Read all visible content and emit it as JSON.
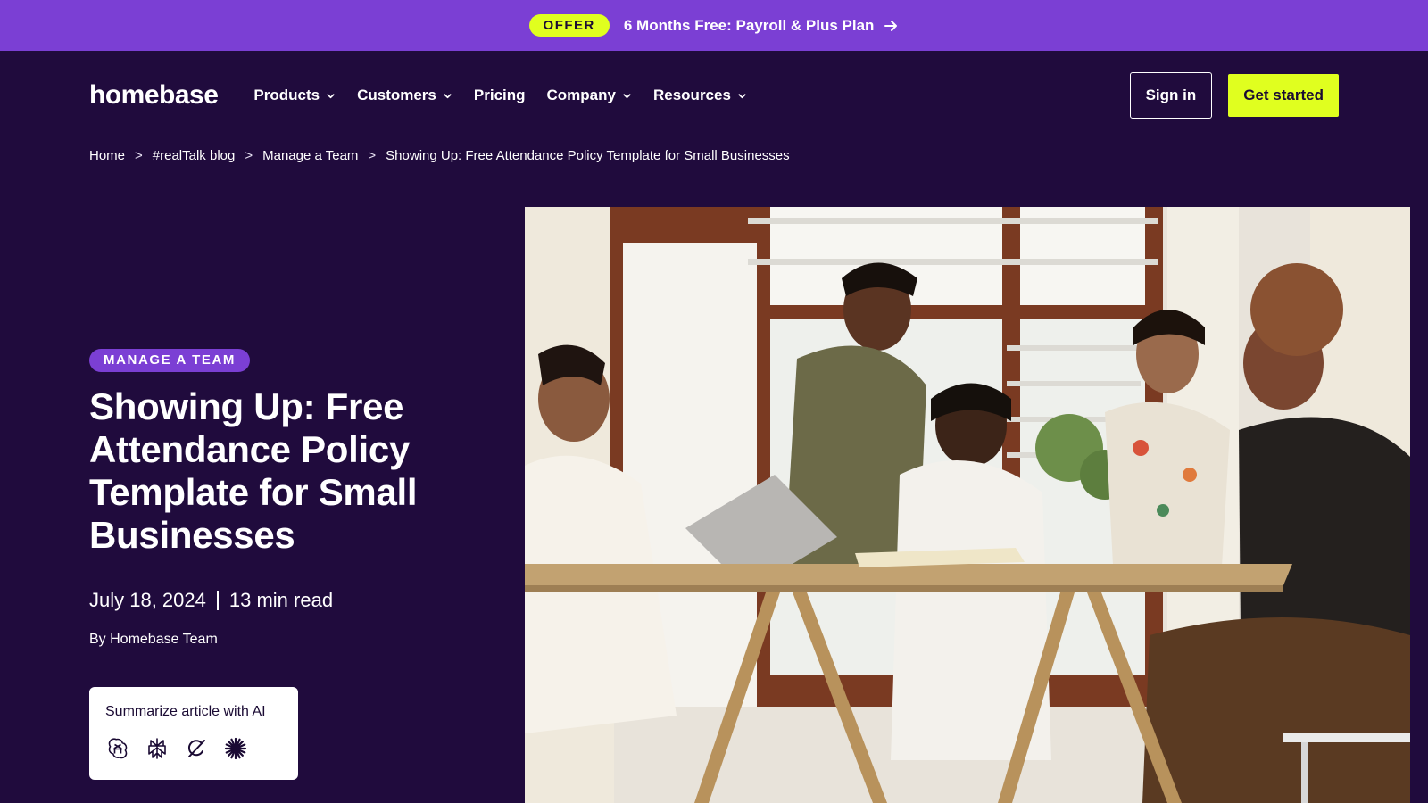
{
  "promo": {
    "badge": "OFFER",
    "text": "6 Months Free: Payroll & Plus Plan",
    "icon": "arrow-right-icon"
  },
  "header": {
    "logo": "homebase",
    "nav": [
      {
        "label": "Products",
        "has_dropdown": true
      },
      {
        "label": "Customers",
        "has_dropdown": true
      },
      {
        "label": "Pricing",
        "has_dropdown": false
      },
      {
        "label": "Company",
        "has_dropdown": true
      },
      {
        "label": "Resources",
        "has_dropdown": true
      }
    ],
    "sign_in": "Sign in",
    "get_started": "Get started"
  },
  "breadcrumb": {
    "items": [
      "Home",
      "#realTalk blog",
      "Manage a Team",
      "Showing Up: Free Attendance Policy Template for Small Businesses"
    ],
    "separator": ">"
  },
  "article": {
    "tag": "MANAGE A TEAM",
    "title": "Showing Up: Free Attendance Policy Template for Small Businesses",
    "date": "July 18, 2024",
    "read_time": "13 min read",
    "author": "By Homebase Team"
  },
  "ai_summary": {
    "title": "Summarize article with AI",
    "icons": [
      "chatgpt-icon",
      "perplexity-icon",
      "grok-icon",
      "claude-icon"
    ]
  },
  "hero_image": {
    "icon": "team-meeting-photo"
  },
  "colors": {
    "background": "#200b3d",
    "promo_bar": "#7b3fd4",
    "accent": "#e0ff1f",
    "tag": "#7b3fd4"
  }
}
